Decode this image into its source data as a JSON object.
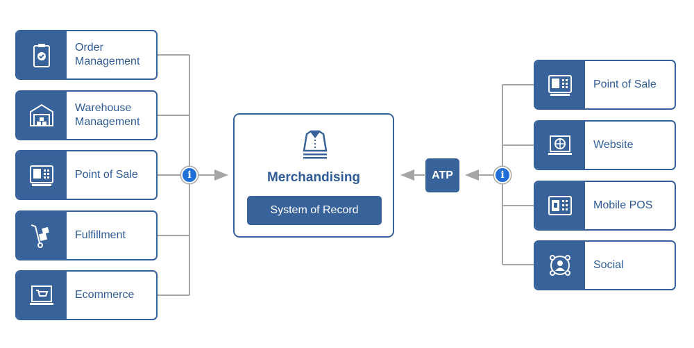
{
  "colors": {
    "primary": "#38639a",
    "text": "#2f5b96",
    "info": "#1f6fd6",
    "connector": "#a5a5a5"
  },
  "left_sources": [
    {
      "label": "Order Management",
      "icon": "clipboard-check-icon"
    },
    {
      "label": "Warehouse Management",
      "icon": "warehouse-icon"
    },
    {
      "label": "Point of Sale",
      "icon": "cash-register-icon"
    },
    {
      "label": "Fulfillment",
      "icon": "hand-truck-icon"
    },
    {
      "label": "Ecommerce",
      "icon": "laptop-cart-icon"
    }
  ],
  "center": {
    "icon": "folded-shirt-icon",
    "title": "Merchandising",
    "subtitle": "System of Record"
  },
  "atp": {
    "label": "ATP"
  },
  "info_symbol": "i",
  "right_channels": [
    {
      "label": "Point of Sale",
      "icon": "cash-register-icon"
    },
    {
      "label": "Website",
      "icon": "laptop-globe-icon"
    },
    {
      "label": "Mobile POS",
      "icon": "mobile-pos-icon"
    },
    {
      "label": "Social",
      "icon": "social-network-icon"
    }
  ]
}
